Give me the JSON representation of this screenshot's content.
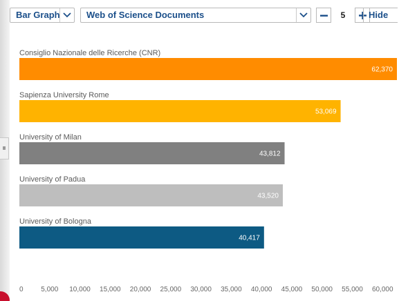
{
  "toolbar": {
    "chart_type_label": "Bar Graph",
    "metric_label": "Web of Science Documents",
    "count_value": "5",
    "hide_label": "Hide"
  },
  "colors": {
    "accent_blue": "#1b4f8a",
    "bar_orange": "#ff8c00",
    "bar_amber": "#ffb300",
    "bar_darkgray": "#808080",
    "bar_lightgray": "#bebebe",
    "bar_navy": "#0d5a83"
  },
  "icons": {
    "chart_type_dropdown": "chevron-down-icon",
    "metric_dropdown": "chevron-down-icon",
    "decrement": "minus-icon",
    "increment": "plus-icon"
  },
  "chart_data": {
    "type": "bar",
    "orientation": "horizontal",
    "categories": [
      "Consiglio Nazionale delle Ricerche (CNR)",
      "Sapienza University Rome",
      "University of Milan",
      "University of Padua",
      "University of Bologna"
    ],
    "values": [
      62370,
      53069,
      43812,
      43520,
      40417
    ],
    "value_labels": [
      "62,370",
      "53,069",
      "43,812",
      "43,520",
      "40,417"
    ],
    "bar_colors": [
      "#ff8c00",
      "#ffb300",
      "#808080",
      "#bebebe",
      "#0d5a83"
    ],
    "xlim": [
      0,
      62370
    ],
    "x_ticks": [
      0,
      5000,
      10000,
      15000,
      20000,
      25000,
      30000,
      35000,
      40000,
      45000,
      50000,
      55000,
      60000
    ],
    "x_tick_labels": [
      "0",
      "5,000",
      "10,000",
      "15,000",
      "20,000",
      "25,000",
      "30,000",
      "35,000",
      "40,000",
      "45,000",
      "50,000",
      "55,000",
      "60,000"
    ],
    "grid": false,
    "legend": "none"
  }
}
